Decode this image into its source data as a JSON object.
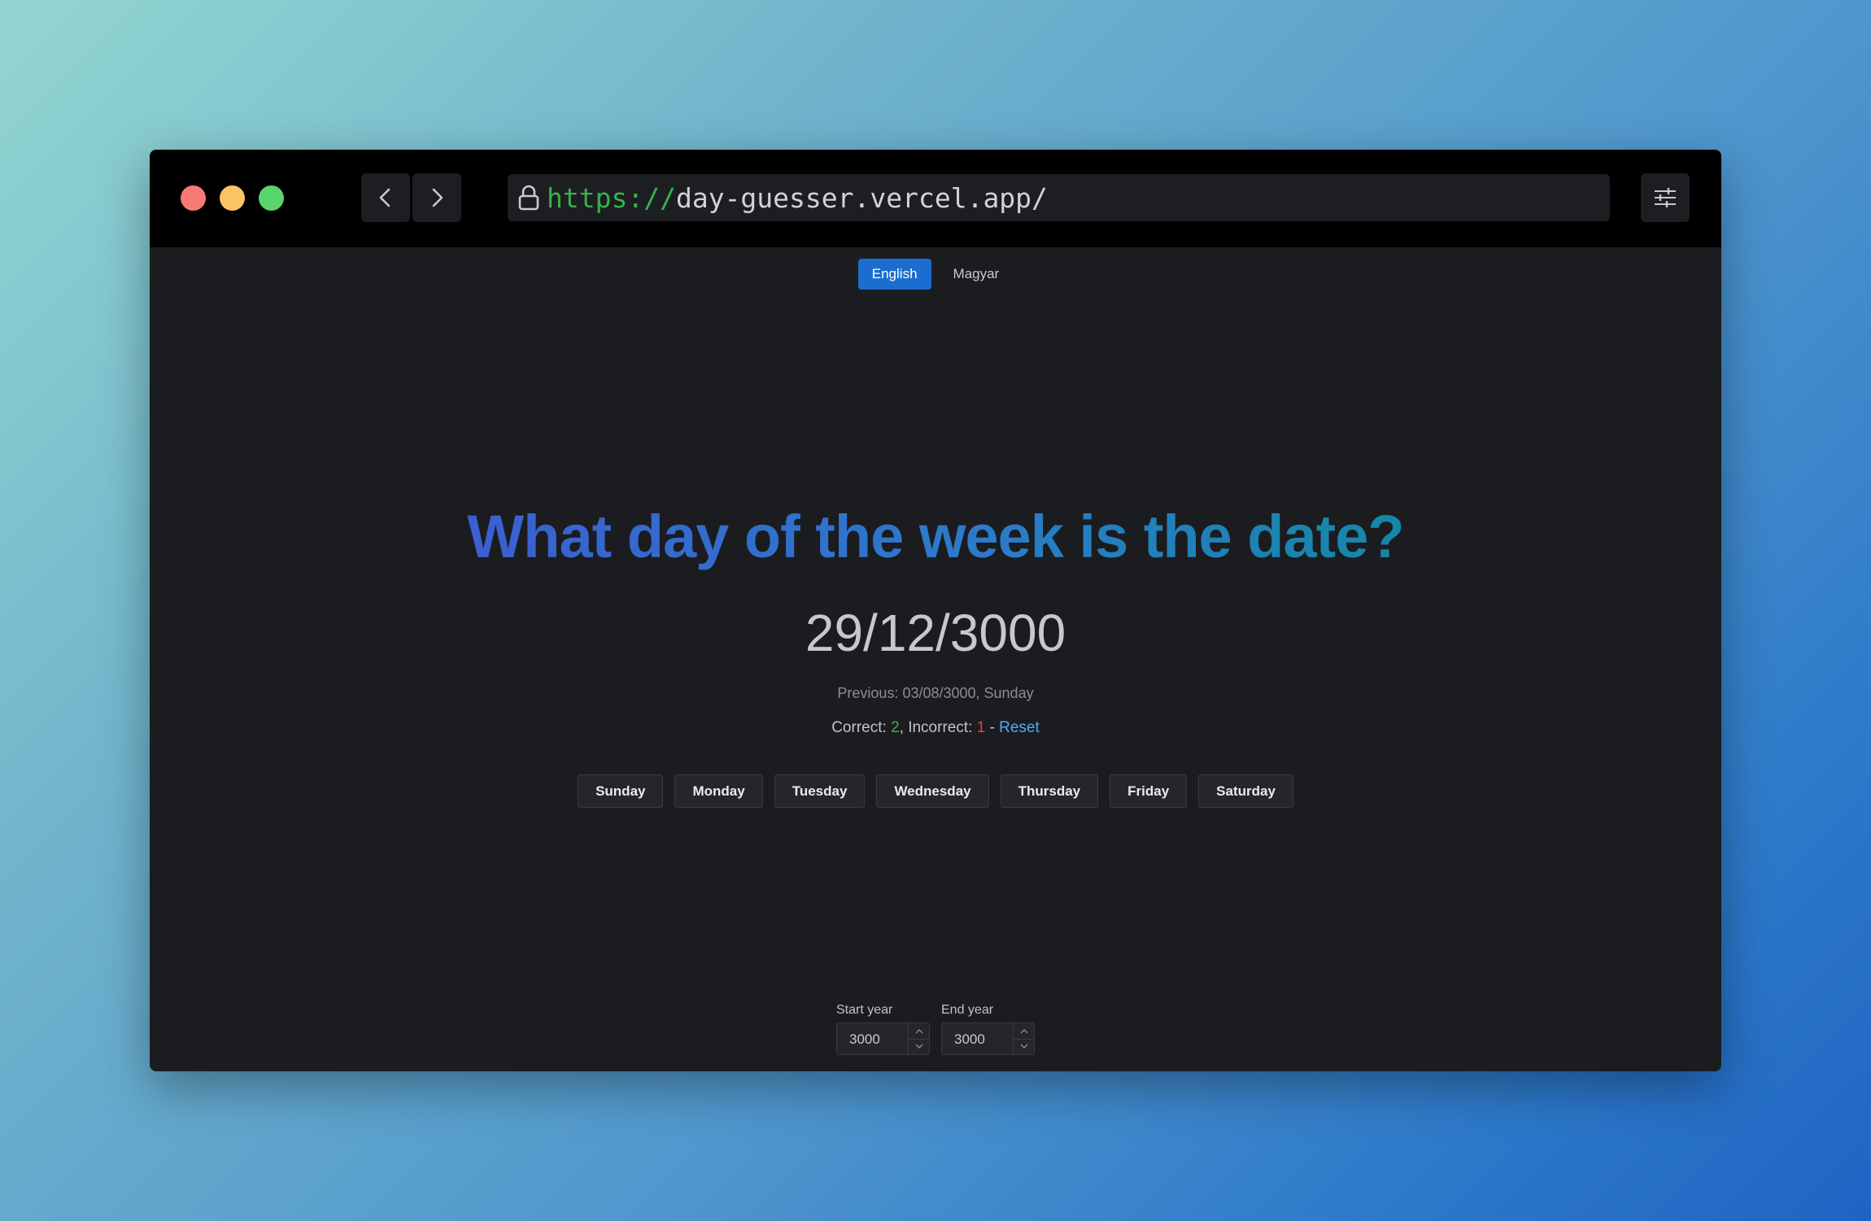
{
  "browser": {
    "url_scheme": "https://",
    "url_host": "day-guesser.vercel.app/"
  },
  "language": {
    "options": [
      "English",
      "Magyar"
    ],
    "selected": "English"
  },
  "main": {
    "title": "What day of the week is the date?",
    "date": "29/12/3000",
    "previous": "Previous: 03/08/3000, Sunday",
    "correct_label": "Correct: ",
    "correct_count": "2",
    "incorrect_label": ", Incorrect: ",
    "incorrect_count": "1",
    "separator": " - ",
    "reset_label": "Reset",
    "days": [
      "Sunday",
      "Monday",
      "Tuesday",
      "Wednesday",
      "Thursday",
      "Friday",
      "Saturday"
    ]
  },
  "years": {
    "start_label": "Start year",
    "start_value": "3000",
    "end_label": "End year",
    "end_value": "3000"
  },
  "colors": {
    "accent": "#1c6dd0",
    "correct": "#37b24d",
    "incorrect": "#f03e3e",
    "link": "#4dabf7",
    "title_gradient_start": "#3b5fd1",
    "title_gradient_end": "#1487a6"
  },
  "icons": {
    "back": "chevron-left-icon",
    "forward": "chevron-right-icon",
    "lock": "lock-icon",
    "settings": "sliders-icon"
  }
}
